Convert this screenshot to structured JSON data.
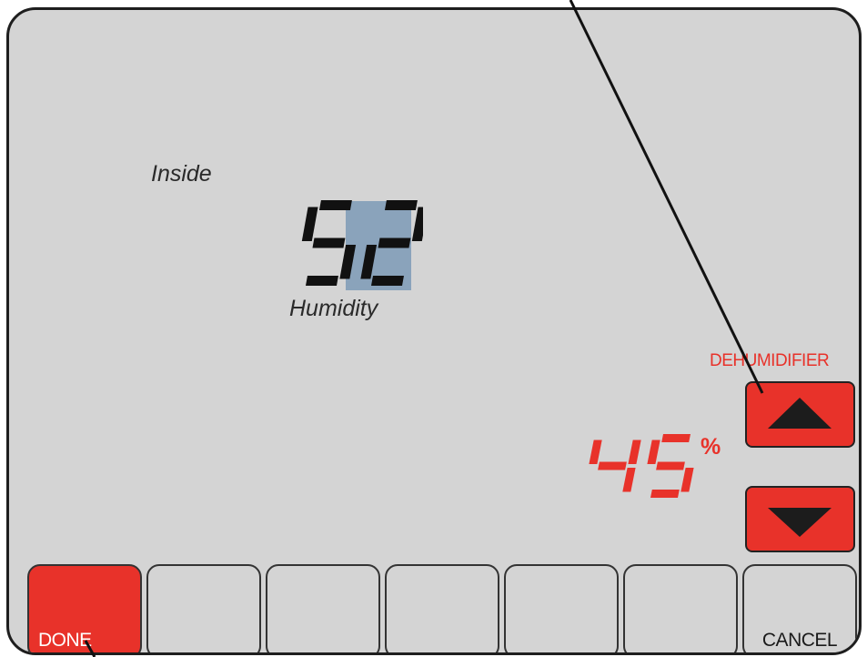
{
  "display": {
    "inside_label": "Inside",
    "humidity_label": "Humidity",
    "inside_humidity": "52",
    "setpoint": "45",
    "setpoint_unit": "%",
    "mode_label": "DEHUMIDIFIER"
  },
  "softkeys": {
    "done": "DONE",
    "cancel": "CANCEL"
  },
  "icons": {
    "up": "arrow-up-icon",
    "down": "arrow-down-icon"
  },
  "colors": {
    "screen_bg": "#d4d4d4",
    "accent_red": "#e8322a",
    "highlight": "#8aa3bb",
    "digit_black": "#111111"
  }
}
